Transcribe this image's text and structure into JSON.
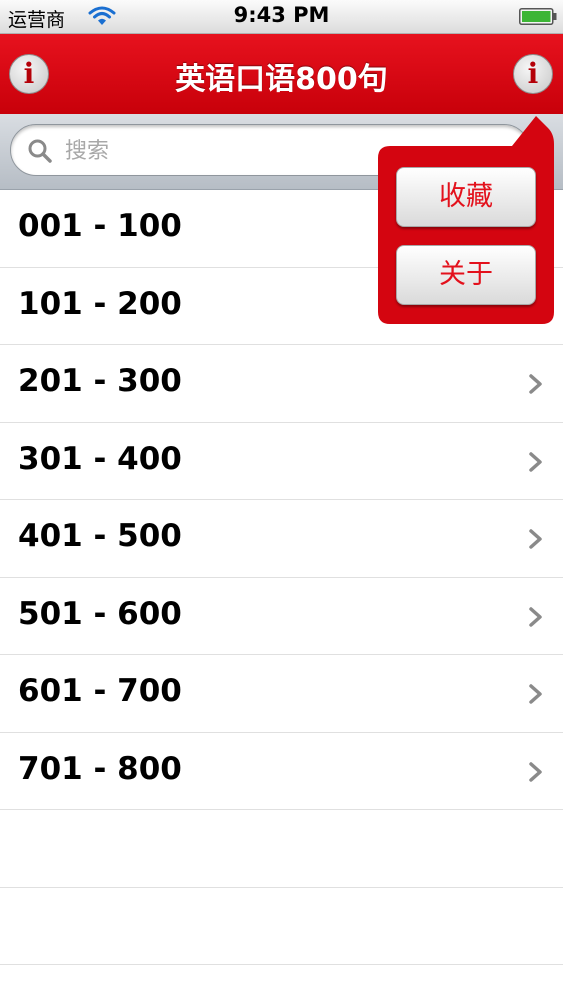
{
  "status_bar": {
    "carrier": "运营商",
    "time": "9:43 PM"
  },
  "nav_bar": {
    "title": "英语口语800句",
    "left_icon": "info-icon",
    "right_icon": "info-icon",
    "info_glyph": "i"
  },
  "search": {
    "placeholder": "搜索",
    "value": ""
  },
  "list": {
    "items": [
      {
        "label": "001 - 100"
      },
      {
        "label": "101 - 200"
      },
      {
        "label": "201 - 300"
      },
      {
        "label": "301 - 400"
      },
      {
        "label": "401 - 500"
      },
      {
        "label": "501 - 600"
      },
      {
        "label": "601 - 700"
      },
      {
        "label": "701 - 800"
      }
    ]
  },
  "popover": {
    "favorites_label": "收藏",
    "about_label": "关于"
  },
  "colors": {
    "accent_red": "#d6000e",
    "popover_red": "#d40510",
    "text_black": "#000000",
    "chevron_gray": "#8a8a8a"
  }
}
